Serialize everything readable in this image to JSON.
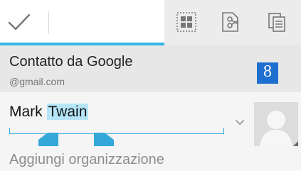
{
  "action_bar": {
    "done_icon": "check-icon",
    "actions": [
      {
        "icon": "select-all-icon"
      },
      {
        "icon": "cut-icon"
      },
      {
        "icon": "copy-icon"
      }
    ],
    "accent_color": "#33b5e5"
  },
  "account": {
    "title": "Contatto da Google",
    "subtitle": "@gmail.com",
    "badge": "8",
    "badge_color": "#1e6fd0"
  },
  "name_editor": {
    "first": "Mark",
    "selected": "Twain",
    "selection_color": "#b6e5f8"
  },
  "organization": {
    "label": "Aggiungi organizzazione"
  }
}
